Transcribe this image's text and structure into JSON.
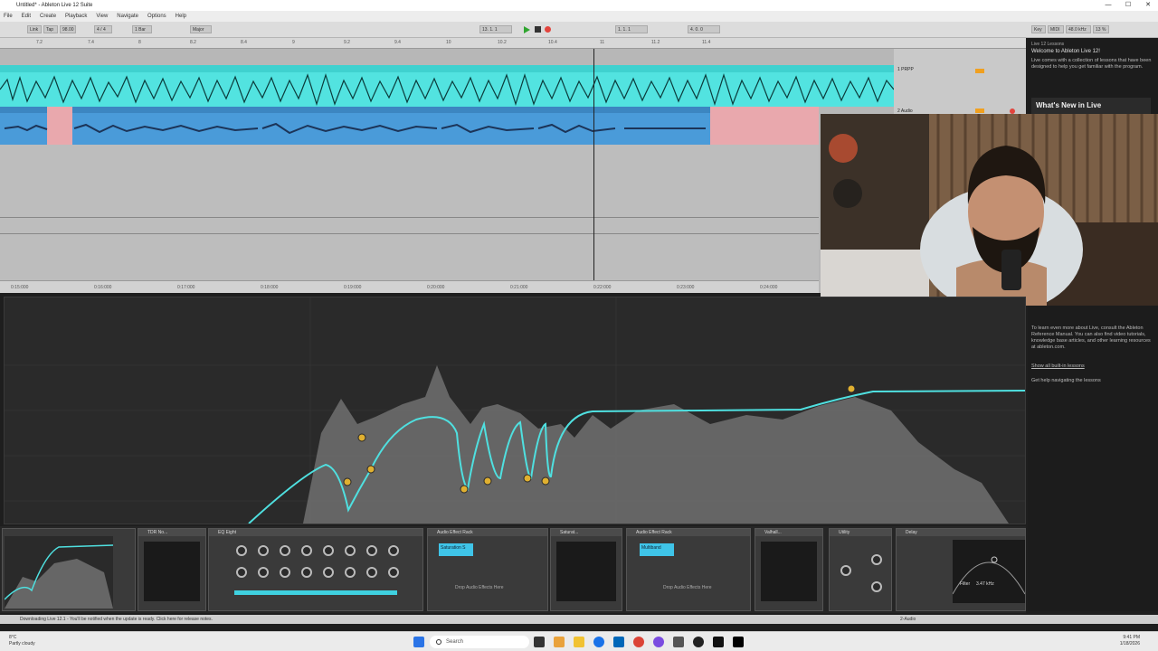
{
  "window": {
    "title": "Untitled* - Ableton Live 12 Suite"
  },
  "menu": [
    "File",
    "Edit",
    "Create",
    "Playback",
    "View",
    "Navigate",
    "Options",
    "Help"
  ],
  "transport": {
    "link": "Link",
    "tap": "Tap",
    "tempo": "98.00",
    "meter": "4 / 4",
    "quant": "1 Bar",
    "scale": "Major",
    "position": "13. 1. 1",
    "loop_start": "1. 1. 1",
    "loop_len": "4. 0. 0",
    "key": "Key",
    "midi": "MIDI",
    "sample_rate": "48.0 kHz",
    "cpu": "13 %"
  },
  "arrangement": {
    "ruler_marks": [
      "7.2",
      "7.4",
      "8",
      "8.2",
      "8.4",
      "9",
      "9.2",
      "9.4",
      "10",
      "10.2",
      "10.4",
      "11",
      "11.2",
      "11.4"
    ],
    "time_marks": [
      "0:15:000",
      "0:16:000",
      "0:17:000",
      "0:18:000",
      "0:19:000",
      "0:20:000",
      "0:21:000",
      "0:22:000",
      "0:23:000",
      "0:24:000"
    ],
    "track1_name": "1 PRPP",
    "track2_name": "2 Audio"
  },
  "help": {
    "panel_title": "Live 12 Lessons",
    "welcome": "Welcome to Ableton Live 12!",
    "description": "Live comes with a collection of lessons that have been designed to help you get familiar with the program.",
    "whats_new": "What's New in Live",
    "more_info": "To learn even more about Live, consult the Ableton Reference Manual. You can also find video tutorials, knowledge base articles, and other learning resources at ableton.com.",
    "show_all": "Show all built-in lessons",
    "get_help": "Get help navigating the lessons"
  },
  "devices": {
    "eq_title": "EQ Eight",
    "tdr_title": "TDR No...",
    "rack1_title": "Audio Effect Rack",
    "rack1_chain": "Saturation S",
    "rack1_drop": "Drop Audio Effects Here",
    "saturator_title": "Saturat...",
    "rack2_title": "Audio Effect Rack",
    "rack2_chain": "Multiband",
    "rack2_drop": "Drop Audio Effects Here",
    "valhalla_title": "Valhall...",
    "utility_title": "Utility",
    "delay_title": "Delay",
    "filter_label": "Filter",
    "filter_val": "3.47 kHz"
  },
  "status": {
    "message": "Downloading Live 12.1 - You'll be notified when the update is ready. Click here for release notes.",
    "track": "2-Audio"
  },
  "taskbar": {
    "temp": "8°C",
    "weather": "Partly cloudy",
    "search": "Search",
    "time": "9:41 PM",
    "date": "1/18/2026"
  }
}
